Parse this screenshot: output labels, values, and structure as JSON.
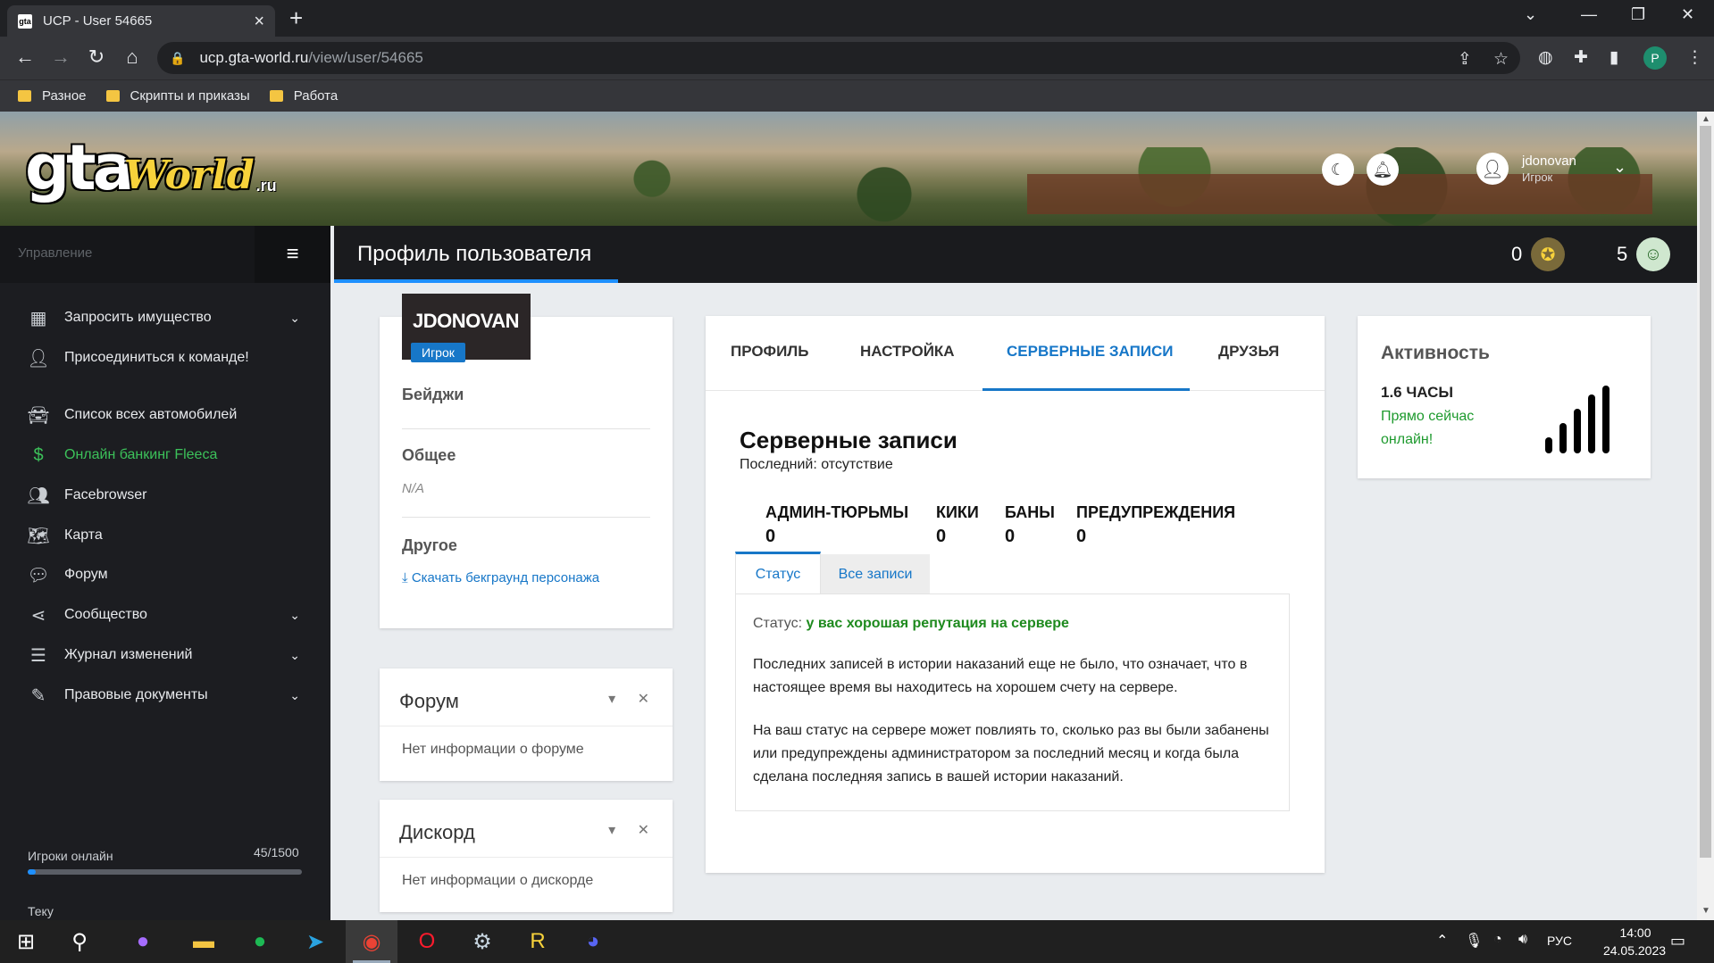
{
  "browser": {
    "tab_title": "UCP - User 54665",
    "tab_favicon_text": "gta",
    "url_host": "ucp.gta-world.ru",
    "url_path": "/view/user/54665",
    "profile_initial": "P",
    "bookmarks": [
      "Разное",
      "Скрипты и приказы",
      "Работа"
    ]
  },
  "header": {
    "logo_gta": "gta",
    "logo_world": "World",
    "logo_ru": ".ru",
    "username": "jdonovan",
    "user_role": "Игрок"
  },
  "sidebar": {
    "title": "Управление",
    "items": [
      {
        "label": "Запросить имущество",
        "icon": "building-icon",
        "chevron": true
      },
      {
        "label": "Присоединиться к команде!",
        "icon": "user-icon",
        "chevron": false
      },
      {
        "label": "Список всех автомобилей",
        "icon": "car-icon",
        "chevron": false
      },
      {
        "label": "Онлайн банкинг Fleeca",
        "icon": "money-icon",
        "chevron": false,
        "color": "#3cc15a"
      },
      {
        "label": "Facebrowser",
        "icon": "users-icon",
        "chevron": false
      },
      {
        "label": "Карта",
        "icon": "map-icon",
        "chevron": false
      },
      {
        "label": "Форум",
        "icon": "comments-icon",
        "chevron": false
      },
      {
        "label": "Сообщество",
        "icon": "share-icon",
        "chevron": true
      },
      {
        "label": "Журнал изменений",
        "icon": "list-icon",
        "chevron": true
      },
      {
        "label": "Правовые документы",
        "icon": "document-icon",
        "chevron": true
      }
    ],
    "players_label": "Игроки онлайн",
    "players_count": "45/1500",
    "players_fraction": 0.03,
    "cut_label": "Теку"
  },
  "titlebar": {
    "page_title": "Профиль пользователя",
    "stat1_value": "0",
    "stat2_value": "5"
  },
  "profile": {
    "name": "JDONOVAN",
    "role": "Игрок",
    "badges_heading": "Бейджи",
    "general_heading": "Общее",
    "general_value": "N/A",
    "other_heading": "Другое",
    "download_link": "Скачать бекграунд персонажа"
  },
  "forum_widget": {
    "title": "Форум",
    "body": "Нет информации о форуме"
  },
  "discord_widget": {
    "title": "Дискорд",
    "body": "Нет информации о дискорде"
  },
  "main": {
    "tabs": [
      "ПРОФИЛЬ",
      "НАСТРОЙКА",
      "СЕРВЕРНЫЕ ЗАПИСИ",
      "ДРУЗЬЯ"
    ],
    "active_tab": 2,
    "records_title": "Серверные записи",
    "records_sub": "Последний: отсутствие",
    "stats": [
      {
        "label": "АДМИН-ТЮРЬМЫ",
        "value": "0"
      },
      {
        "label": "КИКИ",
        "value": "0"
      },
      {
        "label": "БАНЫ",
        "value": "0"
      },
      {
        "label": "ПРЕДУПРЕЖДЕНИЯ",
        "value": "0"
      }
    ],
    "sub_tabs": [
      "Статус",
      "Все записи"
    ],
    "status_prefix": "Статус:",
    "status_value": "у вас хорошая репутация на сервере",
    "paragraph1": "Последних записей в истории наказаний еще не было, что означает, что в настоящее время вы находитесь на хорошем счету на сервере.",
    "paragraph2": "На ваш статус на сервере может повлиять то, сколько раз вы были забанены или предупреждены администратором за последний месяц и когда была сделана последняя запись в вашей истории наказаний."
  },
  "activity": {
    "title": "Активность",
    "hours": "1.6 ЧАСЫ",
    "online": "Прямо сейчас онлайн!"
  },
  "taskbar": {
    "lang": "РУС",
    "time": "14:00",
    "date": "24.05.2023"
  },
  "colors": {
    "accent": "#1777c8",
    "sidebar_bg": "#1c1d21",
    "success": "#1e8a1e"
  }
}
